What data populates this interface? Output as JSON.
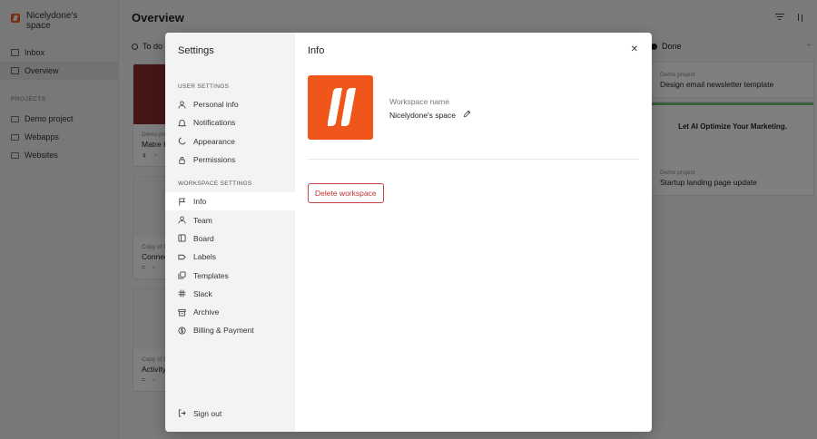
{
  "sidebar": {
    "workspace_name": "Nicelydone's space",
    "items": [
      {
        "label": "Inbox"
      },
      {
        "label": "Overview"
      }
    ],
    "projects_label": "PROJECTS",
    "projects": [
      {
        "label": "Demo project"
      },
      {
        "label": "Webapps"
      },
      {
        "label": "Websites"
      }
    ]
  },
  "main": {
    "title": "Overview",
    "columns": {
      "todo": "To do",
      "done": "Done"
    },
    "cards_left": [
      {
        "meta": "Demo pro",
        "title": "Matre H"
      },
      {
        "meta": "Copy of D",
        "title": "Connec"
      },
      {
        "meta": "Copy of D",
        "title": "Activity"
      }
    ],
    "cards_right": [
      {
        "meta": "Demo project",
        "title": "Design email newsletter template"
      },
      {
        "meta": "Demo project",
        "title": "Startup landing page update",
        "thumb_text": "Let AI Optimize Your Marketing."
      }
    ]
  },
  "modal": {
    "title": "Settings",
    "user_section": "USER SETTINGS",
    "user_items": [
      {
        "label": "Personal info",
        "icon": "user-icon"
      },
      {
        "label": "Notifications",
        "icon": "bell-icon"
      },
      {
        "label": "Appearance",
        "icon": "moon-icon"
      },
      {
        "label": "Permissions",
        "icon": "lock-icon"
      }
    ],
    "workspace_section": "WORKSPACE SETTINGS",
    "workspace_items": [
      {
        "label": "Info",
        "icon": "flag-icon"
      },
      {
        "label": "Team",
        "icon": "team-icon"
      },
      {
        "label": "Board",
        "icon": "board-icon"
      },
      {
        "label": "Labels",
        "icon": "label-icon"
      },
      {
        "label": "Templates",
        "icon": "templates-icon"
      },
      {
        "label": "Slack",
        "icon": "slack-icon"
      },
      {
        "label": "Archive",
        "icon": "archive-icon"
      },
      {
        "label": "Billing & Payment",
        "icon": "billing-icon"
      }
    ],
    "sign_out": "Sign out",
    "panel_title": "Info",
    "workspace_name_label": "Workspace name",
    "workspace_name_value": "Nicelydone's space",
    "delete_label": "Delete workspace",
    "close_symbol": "✕"
  },
  "colors": {
    "brand": "#f0561a",
    "danger": "#c24444"
  }
}
